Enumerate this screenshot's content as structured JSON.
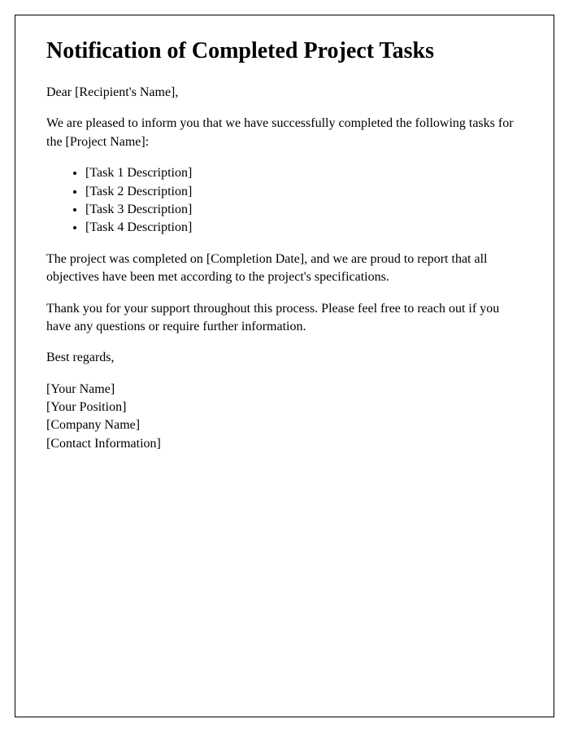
{
  "title": "Notification of Completed Project Tasks",
  "salutation": "Dear [Recipient's Name],",
  "intro": "We are pleased to inform you that we have successfully completed the following tasks for the [Project Name]:",
  "tasks": [
    "[Task 1 Description]",
    "[Task 2 Description]",
    "[Task 3 Description]",
    "[Task 4 Description]"
  ],
  "completion_paragraph": "The project was completed on [Completion Date], and we are proud to report that all objectives have been met according to the project's specifications.",
  "thanks_paragraph": "Thank you for your support throughout this process. Please feel free to reach out if you have any questions or require further information.",
  "closing": "Best regards,",
  "signature": {
    "name": "[Your Name]",
    "position": "[Your Position]",
    "company": "[Company Name]",
    "contact": "[Contact Information]"
  }
}
